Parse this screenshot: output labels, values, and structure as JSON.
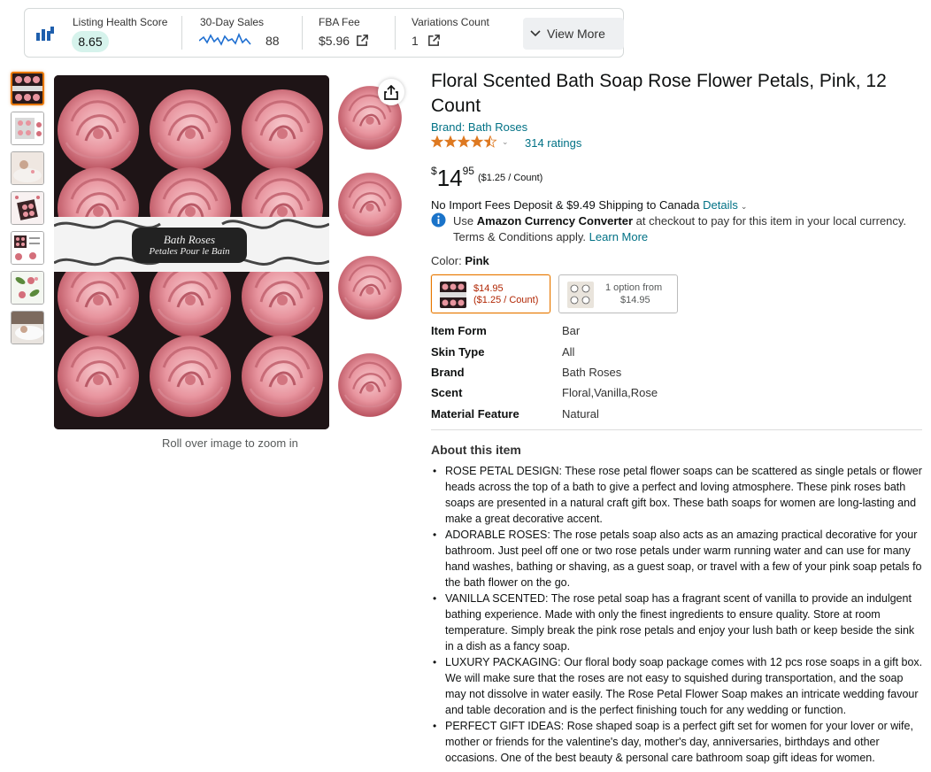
{
  "metrics": {
    "listing_health": {
      "label": "Listing Health Score",
      "value": "8.65"
    },
    "sales": {
      "label": "30-Day Sales",
      "value": "88"
    },
    "fba": {
      "label": "FBA Fee",
      "value": "$5.96"
    },
    "variations": {
      "label": "Variations Count",
      "value": "1"
    },
    "view_more": "View More"
  },
  "gallery": {
    "thumbnail_count": 7,
    "active_index": 0,
    "zoom_hint": "Roll over image to zoom in",
    "box_label_line1": "Bath Roses",
    "box_label_line2": "Petales Pour le Bain"
  },
  "product": {
    "title": "Floral Scented Bath Soap Rose Flower Petals, Pink, 12 Count",
    "brand_link": "Brand: Bath Roses",
    "rating": 4.5,
    "ratings_count": "314 ratings",
    "price": {
      "symbol": "$",
      "whole": "14",
      "fraction": "95",
      "per_unit": "($1.25 / Count)"
    },
    "shipping": {
      "text": "No Import Fees Deposit & $9.49 Shipping to Canada",
      "link": "Details"
    },
    "currency": {
      "prefix": "Use",
      "bold": "Amazon Currency Converter",
      "suffix": "at checkout to pay for this item in your local currency.",
      "line2": "Terms & Conditions apply.",
      "link": "Learn More"
    },
    "color": {
      "label": "Color:",
      "value": "Pink"
    },
    "options": [
      {
        "line1": "$14.95",
        "line2": "($1.25 / Count)"
      },
      {
        "line1": "1 option from",
        "line2": "$14.95"
      }
    ],
    "specs": [
      {
        "key": "Item Form",
        "value": "Bar"
      },
      {
        "key": "Skin Type",
        "value": "All"
      },
      {
        "key": "Brand",
        "value": "Bath Roses"
      },
      {
        "key": "Scent",
        "value": "Floral,Vanilla,Rose"
      },
      {
        "key": "Material Feature",
        "value": "Natural"
      }
    ],
    "about_heading": "About this item",
    "bullets": [
      "ROSE PETAL DESIGN: These rose petal flower soaps can be scattered as single petals or flower heads across the top of a bath to give a perfect and loving atmosphere. These pink roses bath soaps are presented in a natural craft gift box. These bath soaps for women are long-lasting and make a great decorative accent.",
      "ADORABLE ROSES: The rose petals soap also acts as an amazing practical decorative for your bathroom. Just peel off one or two rose petals under warm running water and can use for many hand washes, bathing or shaving, as a guest soap, or travel with a few of your pink soap petals fo the bath flower on the go.",
      "VANILLA SCENTED: The rose petal soap has a fragrant scent of vanilla to provide an indulgent bathing experience. Made with only the finest ingredients to ensure quality. Store at room temperature. Simply break the pink rose petals and enjoy your lush bath or keep beside the sink in a dish as a fancy soap.",
      "LUXURY PACKAGING: Our floral body soap package comes with 12 pcs rose soaps in a gift box. We will make sure that the roses are not easy to squished during transportation, and the soap may not dissolve in water easily. The Rose Petal Flower Soap makes an intricate wedding favour and table decoration and is the perfect finishing touch for any wedding or function.",
      "PERFECT GIFT IDEAS: Rose shaped soap is a perfect gift set for women for your lover or wife, mother or friends for the valentine's day, mother's day, anniversaries, birthdays and other occasions. One of the best beauty & personal care bathroom soap gift ideas for women."
    ]
  },
  "colors": {
    "link": "#007185",
    "accent_orange": "#e77600",
    "price_red": "#b12704",
    "star": "#de7921",
    "rose_pink": "#e5909a"
  }
}
